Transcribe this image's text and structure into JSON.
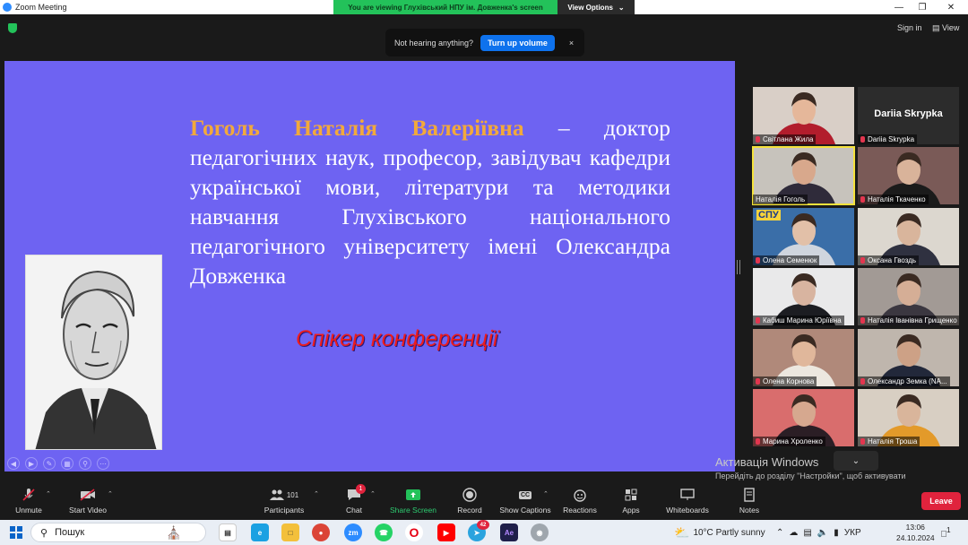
{
  "window": {
    "title": "Zoom Meeting"
  },
  "banner": {
    "message": "You are viewing Глухівський НПУ ім. Довженка's screen",
    "view_options": "View Options"
  },
  "top": {
    "sign_in": "Sign in",
    "view": "View"
  },
  "notification": {
    "text": "Not hearing anything?",
    "button": "Turn up volume",
    "close": "×"
  },
  "slide": {
    "name": "Гоголь Наталія Валеріївна",
    "description": " – доктор педагогічних наук, професор, завідувач кафедри української мови, літератури та методики навчання Глухівського національного педагогічного університету імені Олександра Довженка",
    "speaker": "Спікер конференції"
  },
  "participants_grid": [
    {
      "name": "Світлана Жила",
      "muted": true,
      "bg": "#d9cfc7",
      "shirt": "#b21d2c",
      "face": "#e5b79a"
    },
    {
      "name": "Dariia Skrypka",
      "muted": true,
      "big_name": "Dariia Skrypka",
      "bg": "#2c2c2c"
    },
    {
      "name": "Наталія Гоголь",
      "muted": false,
      "active": true,
      "bg": "#c7c3bc",
      "shirt": "#2f2b3a",
      "face": "#d8a88c"
    },
    {
      "name": "Наталія Ткаченко",
      "muted": true,
      "bg": "#7a5a57",
      "shirt": "#1b1b1b",
      "face": "#d9b39a"
    },
    {
      "name": "Олена Семенюк",
      "muted": true,
      "logo": "СПУ",
      "bg": "#3a6ea8",
      "shirt": "#cfd5de",
      "face": "#e2c0a8"
    },
    {
      "name": "Оксана Гвоздь",
      "muted": true,
      "bg": "#dcd7cf",
      "shirt": "#2f3140",
      "face": "#d9b59c"
    },
    {
      "name": "Кабиш Марина Юріївна",
      "muted": true,
      "bg": "#e9e9ea",
      "shirt": "#1c1d22",
      "face": "#d8b4a0"
    },
    {
      "name": "Наталія Іванівна Грищенко",
      "muted": true,
      "bg": "#a29a95",
      "shirt": "#3b3740",
      "face": "#d5ae96"
    },
    {
      "name": "Олена Корнова",
      "muted": true,
      "bg": "#b0897a",
      "shirt": "#ece7df",
      "face": "#e0b79b"
    },
    {
      "name": "Олександр Земка (NA...",
      "muted": true,
      "bg": "#bfb6ad",
      "shirt": "#22283a",
      "face": "#cda186"
    },
    {
      "name": "Марина Хроленко",
      "muted": true,
      "bg": "#d96d6d",
      "shirt": "#2b1e25",
      "face": "#d6a88f"
    },
    {
      "name": "Наталія Троша",
      "muted": true,
      "bg": "#d8cfc3",
      "shirt": "#e39a2a",
      "face": "#d9b59b"
    }
  ],
  "activation": {
    "title": "Активація Windows",
    "sub": "Перейдіть до розділу \"Настройки\", щоб активувати Windows."
  },
  "toolbar": {
    "unmute": "Unmute",
    "start_video": "Start Video",
    "participants": "Participants",
    "participants_count": "101",
    "chat": "Chat",
    "chat_badge": "1",
    "share_screen": "Share Screen",
    "record": "Record",
    "show_captions": "Show Captions",
    "captions_icon": "CC",
    "reactions": "Reactions",
    "apps": "Apps",
    "whiteboards": "Whiteboards",
    "notes": "Notes",
    "leave": "Leave"
  },
  "taskbar": {
    "search": "Пошук",
    "weather_temp": "10°C",
    "weather_text": "Partly sunny",
    "lang": "УКР",
    "time": "13:06",
    "date": "24.10.2024",
    "telegram_badge": "42",
    "notif_count": "1"
  },
  "colors": {
    "slide_bg": "#6e63f2",
    "name_color": "#f2a93b",
    "speaker_color": "#ee1c1c",
    "share_green": "#23c25a",
    "leave_red": "#e0233d"
  }
}
